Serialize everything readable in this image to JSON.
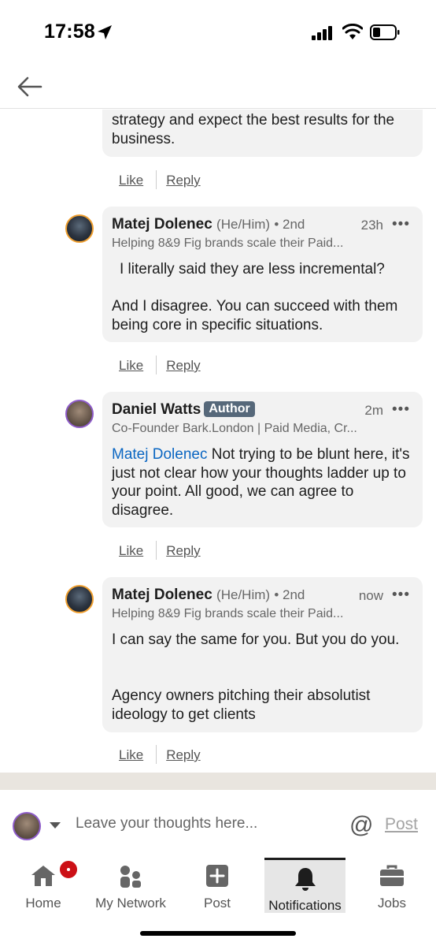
{
  "status_bar": {
    "time": "17:58"
  },
  "header": {
    "back_icon": "arrow-left-icon"
  },
  "thread": {
    "partial_comment": {
      "text": "strategy and expect the best results for the business."
    },
    "actions": {
      "like_label": "Like",
      "reply_label": "Reply"
    },
    "comments": [
      {
        "name": "Matej Dolenec",
        "pronouns": "(He/Him)",
        "degree": "• 2nd",
        "time": "23h",
        "headline": "Helping 8&9 Fig brands scale their Paid...",
        "para1": "I literally said they are less incremental?",
        "para2": "And I disagree. You can succeed with them being core in specific situations."
      },
      {
        "name": "Daniel Watts",
        "badge": "Author",
        "time": "2m",
        "headline": "Co-Founder Bark.London | Paid Media, Cr...",
        "mention": "Matej Dolenec",
        "para1": "Not trying to be blunt here, it's just not clear how your thoughts ladder up to your point. All good, we can agree to disagree."
      },
      {
        "name": "Matej Dolenec",
        "pronouns": "(He/Him)",
        "degree": "• 2nd",
        "time": "now",
        "headline": "Helping 8&9 Fig brands scale their Paid...",
        "para1": "I can say the same for you. But you do you.",
        "para2": "Agency owners pitching their absolutist ideology to get clients"
      }
    ],
    "more_label": "•••"
  },
  "compose": {
    "placeholder": "Leave your thoughts here...",
    "at_symbol": "@",
    "post_label": "Post"
  },
  "nav": {
    "items": [
      {
        "label": "Home",
        "icon": "home-icon"
      },
      {
        "label": "My Network",
        "icon": "network-icon"
      },
      {
        "label": "Post",
        "icon": "plus-icon"
      },
      {
        "label": "Notifications",
        "icon": "bell-icon",
        "active": true
      },
      {
        "label": "Jobs",
        "icon": "briefcase-icon"
      }
    ]
  },
  "colors": {
    "mention": "#0a66c2",
    "author_badge": "#56687a",
    "notification_badge": "#cc1016",
    "bubble": "#f2f2f2"
  }
}
